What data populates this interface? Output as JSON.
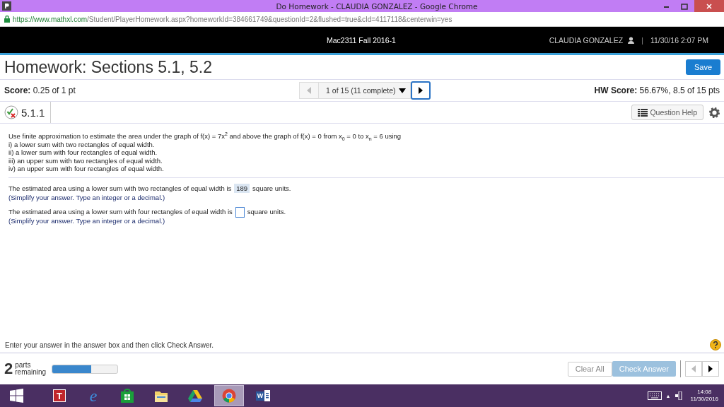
{
  "window": {
    "title": "Do Homework - CLAUDIA GONZALEZ - Google Chrome",
    "url_host": "https://www.mathxl.com",
    "url_path": "/Student/PlayerHomework.aspx?homeworkId=384661749&questionId=2&flushed=true&cId=4117118&centerwin=yes"
  },
  "header": {
    "course": "Mac2311 Fall 2016-1",
    "user": "CLAUDIA GONZALEZ",
    "separator": "|",
    "datetime": "11/30/16 2:07 PM"
  },
  "assignment": {
    "title": "Homework: Sections 5.1, 5.2",
    "save": "Save",
    "score": "**Score:** 0.25 of 1 pt",
    "hw_score": "**HW Score:** 56.67%, 8.5 of 15 pts"
  },
  "navigator": {
    "position": "1 of 15 (11 complete)",
    "prev_disabled": true,
    "next_disabled": false
  },
  "question": {
    "number": "5.1.1",
    "help": "Question Help",
    "prompt": "Use finite approximation to estimate the area under the graph of f(x) = 7x$^{2}$  and above the graph of f(x) = 0 from x$_{0}$ = 0 to x$_{n}$ = 6 using",
    "items": [
      "i) a lower sum with two rectangles of equal width.",
      "ii) a lower sum with four rectangles of equal width.",
      "iii) an upper sum with two rectangles of equal width.",
      "iv) an upper sum with four rectangles of equal width."
    ],
    "answers": [
      {
        "before": "The estimated area using a lower sum with two rectangles of equal width is",
        "value": "189",
        "after": "square units.",
        "hint": "(Simplify your answer. Type an integer or a decimal.)"
      },
      {
        "before": "The estimated area using a lower sum with four rectangles of equal width is",
        "after": "square units.",
        "hint": "(Simplify your answer. Type an integer or a decimal.)"
      }
    ]
  },
  "instruction": "Enter your answer in the answer box and then click Check Answer.",
  "footer": {
    "parts_count": "2",
    "parts_label_1": "parts",
    "parts_label_2": "remaining",
    "level": 0.6,
    "clear": "Clear All",
    "check": "Check Answer",
    "check_disabled": true,
    "prev_disabled": true,
    "next_disabled": false
  },
  "taskbar": {
    "apps": [
      {
        "kind": "start",
        "selected": false
      },
      {
        "kind": "letter",
        "label": "T",
        "selected": false
      },
      {
        "kind": "browser-e",
        "label": "e",
        "selected": false
      },
      {
        "kind": "store",
        "selected": false
      },
      {
        "kind": "folder",
        "selected": false
      },
      {
        "kind": "drive",
        "selected": false
      },
      {
        "kind": "chrome",
        "selected": true
      },
      {
        "kind": "word",
        "label": "W",
        "selected": false
      }
    ],
    "time": "14:08",
    "date": "11/30/2016",
    "tray_caret": "▲"
  }
}
